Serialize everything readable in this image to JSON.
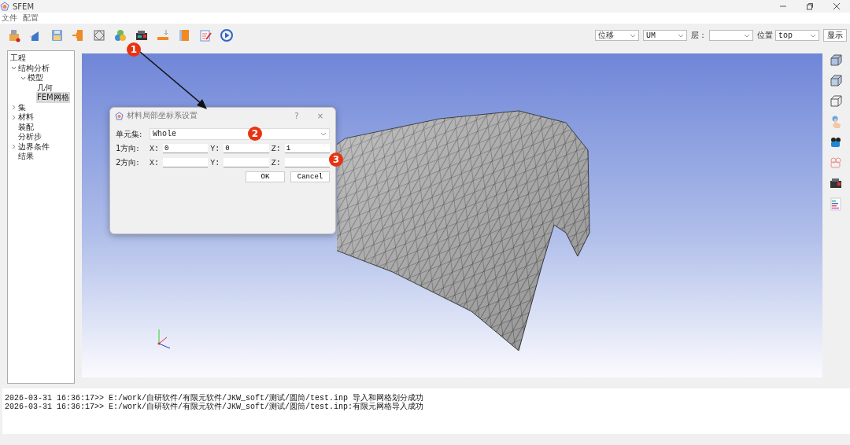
{
  "window": {
    "title": "SFEM"
  },
  "menu": [
    {
      "label": "文件"
    },
    {
      "label": "配置"
    }
  ],
  "view_controls": {
    "result": "位移",
    "component": "UM",
    "layer_label": "层：",
    "position_label": "位置",
    "position": "top",
    "show_button": "显示"
  },
  "tree": {
    "root": "工程",
    "items": [
      {
        "label": "结构分析",
        "expanded": true,
        "selected": false,
        "children": [
          {
            "label": "模型",
            "expanded": true,
            "selected": false,
            "children": [
              {
                "label": "几何",
                "selected": false
              },
              {
                "label": "FEM网格",
                "selected": true
              }
            ]
          }
        ]
      },
      {
        "label": "集",
        "expanded": false,
        "selected": false
      },
      {
        "label": "材料",
        "expanded": false,
        "selected": false
      },
      {
        "label": "装配",
        "selected": false
      },
      {
        "label": "分析步",
        "selected": false
      },
      {
        "label": "边界条件",
        "expanded": false,
        "selected": false
      },
      {
        "label": "结果",
        "selected": false
      }
    ]
  },
  "dialog": {
    "title": "材料局部坐标系设置",
    "help": "?",
    "close": "×",
    "element_set_label": "单元集:",
    "element_set": "Whole",
    "rows": [
      {
        "label": "1方向:",
        "fields": [
          {
            "axis": "X:",
            "value": "0"
          },
          {
            "axis": "Y:",
            "value": "0"
          },
          {
            "axis": "Z:",
            "value": "1"
          }
        ]
      },
      {
        "label": "2方向:",
        "fields": [
          {
            "axis": "X:"
          },
          {
            "axis": "Y:"
          },
          {
            "axis": "Z:"
          }
        ]
      }
    ],
    "buttons": [
      "OK",
      "Cancel"
    ]
  },
  "callouts": [
    "1",
    "2",
    "3"
  ],
  "log": [
    "2026-03-31 16:36:17>> E:/work/自研软件/有限元软件/JKW_soft/测试/圆筒/test.inp 导入和网格划分成功",
    "2026-03-31 16:36:17>> E:/work/自研软件/有限元软件/JKW_soft/测试/圆筒/test.inp:有限元网格导入成功"
  ]
}
